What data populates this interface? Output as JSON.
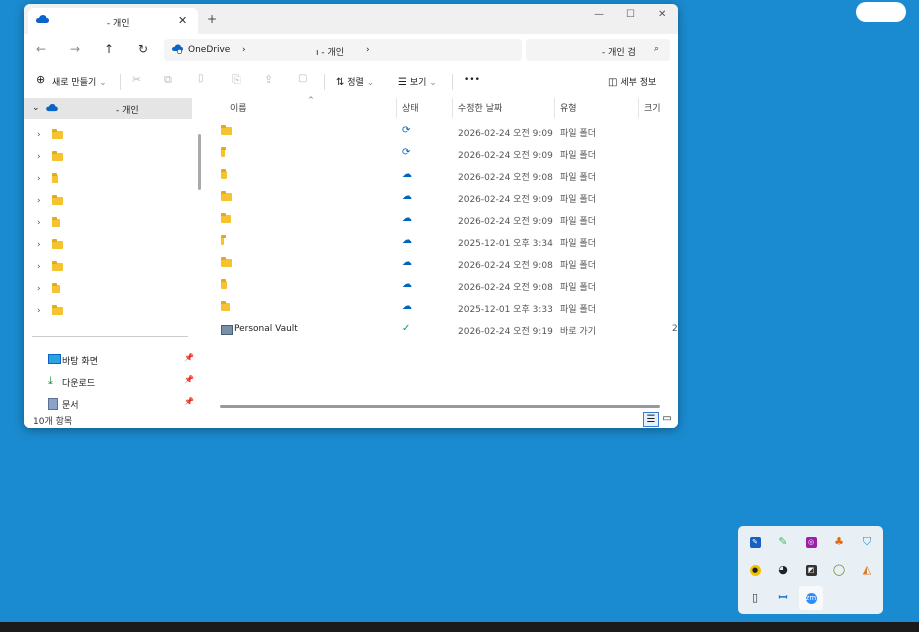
{
  "tab": {
    "title_suffix": "- 개인",
    "close": "✕",
    "new_tab": "+"
  },
  "window_controls": {
    "minimize": "—",
    "maximize": "☐",
    "close": "✕"
  },
  "nav": {
    "back": "←",
    "forward": "→",
    "up": "↑",
    "refresh": "↻"
  },
  "address": {
    "root": "OneDrive",
    "sep1": "›",
    "crumb2": "ı - 개인",
    "sep2": "›"
  },
  "search": {
    "placeholder": "- 개인 검",
    "icon": "⌕"
  },
  "toolbar": {
    "new_label": "새로 만들기",
    "sort_label": "정렬",
    "view_label": "보기",
    "more": "•••",
    "details_label": "세부 정보",
    "cut": "✂",
    "copy": "⧉",
    "paste": "📋",
    "rename": "⎘",
    "share": "⇪",
    "delete": "🗑"
  },
  "navpane": {
    "top_label": "- 개인",
    "folders": 9,
    "quick_access": [
      {
        "label": "바탕 화면",
        "icon": "desktop-icon"
      },
      {
        "label": "다운로드",
        "icon": "download-icon"
      },
      {
        "label": "문서",
        "icon": "document-icon"
      }
    ]
  },
  "columns": {
    "name": "이름",
    "status": "상태",
    "modified": "수정한 날짜",
    "type": "유형",
    "size": "크기"
  },
  "rows": [
    {
      "name": "",
      "status": "sync",
      "modified": "2026-02-24 오전 9:09",
      "type": "파일 폴더",
      "size": ""
    },
    {
      "name": "",
      "status": "sync",
      "modified": "2026-02-24 오전 9:09",
      "type": "파일 폴더",
      "size": ""
    },
    {
      "name": "",
      "status": "cloud",
      "modified": "2026-02-24 오전 9:08",
      "type": "파일 폴더",
      "size": ""
    },
    {
      "name": "",
      "status": "cloud",
      "modified": "2026-02-24 오전 9:09",
      "type": "파일 폴더",
      "size": ""
    },
    {
      "name": "",
      "status": "cloud",
      "modified": "2026-02-24 오전 9:09",
      "type": "파일 폴더",
      "size": ""
    },
    {
      "name": "",
      "status": "cloud",
      "modified": "2025-12-01 오후 3:34",
      "type": "파일 폴더",
      "size": ""
    },
    {
      "name": "",
      "status": "cloud",
      "modified": "2026-02-24 오전 9:08",
      "type": "파일 폴더",
      "size": ""
    },
    {
      "name": "",
      "status": "cloud",
      "modified": "2026-02-24 오전 9:08",
      "type": "파일 폴더",
      "size": ""
    },
    {
      "name": "",
      "status": "cloud",
      "modified": "2025-12-01 오후 3:33",
      "type": "파일 폴더",
      "size": ""
    },
    {
      "name": "Personal Vault",
      "status": "ok",
      "modified": "2026-02-24 오전 9:19",
      "type": "바로 가기",
      "size": "2"
    }
  ],
  "statusbar": {
    "count": "10개 항목"
  },
  "colors": {
    "desktop": "#1a8bd0",
    "accent": "#0a64c8",
    "folder": "#f5c230",
    "selected": "#e5e5e5",
    "sync": "#0067c0",
    "ok": "#0f9d58"
  }
}
